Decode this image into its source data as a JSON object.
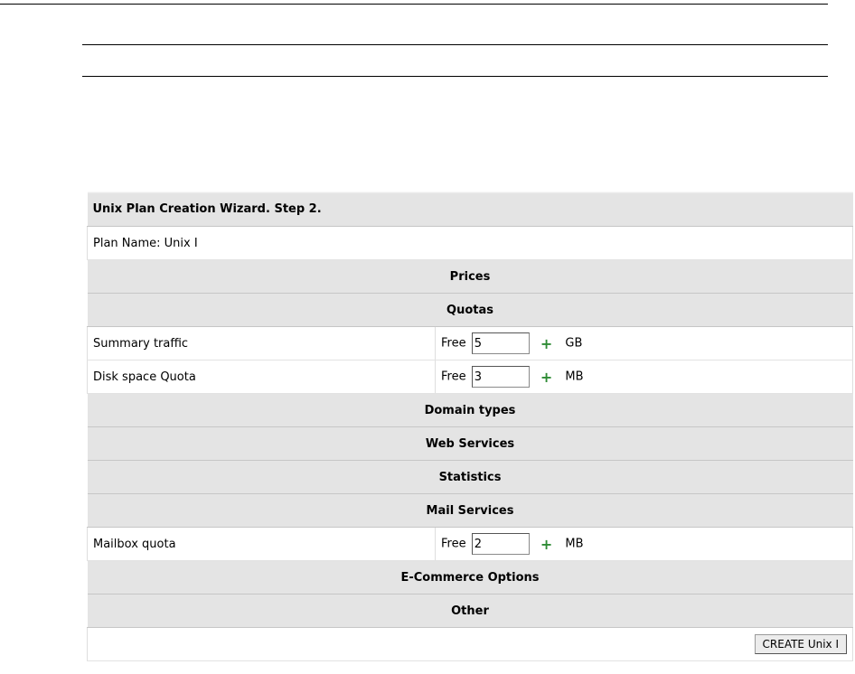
{
  "wizard": {
    "title": "Unix Plan Creation Wizard. Step 2.",
    "plan_name": "Plan Name: Unix I",
    "sections": {
      "prices": "Prices",
      "quotas": "Quotas",
      "domain_types": "Domain types",
      "web_services": "Web Services",
      "statistics": "Statistics",
      "mail_services": "Mail Services",
      "ecommerce": "E-Commerce Options",
      "other": "Other"
    },
    "quotas": [
      {
        "label": "Summary traffic",
        "free_label": "Free",
        "value": "5",
        "unit": "GB"
      },
      {
        "label": "Disk space Quota",
        "free_label": "Free",
        "value": "3",
        "unit": "MB"
      }
    ],
    "mail": [
      {
        "label": "Mailbox quota",
        "free_label": "Free",
        "value": "2",
        "unit": "MB"
      }
    ],
    "plus_symbol": "+",
    "create_button": "CREATE Unix I"
  },
  "colors": {
    "plus": "#2e8b34",
    "stripe_light": "#ebebeb",
    "stripe_dark": "#dcdcdc"
  }
}
